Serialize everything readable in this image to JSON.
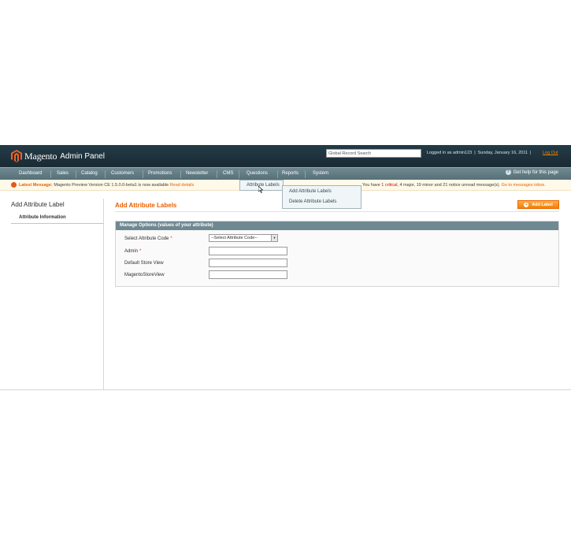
{
  "header": {
    "logo_text": "Magento",
    "logo_sub": "Admin Panel",
    "search_value": "Global Record Search",
    "user_info": "Logged in as admin123",
    "date_info": "Sunday, January 16, 2011",
    "logout_label": "Log Out"
  },
  "nav": {
    "items": [
      "Dashboard",
      "Sales",
      "Catalog",
      "Customers",
      "Promotions",
      "Newsletter",
      "CMS",
      "Questions",
      "Reports",
      "System"
    ],
    "help_label": "Get help for this page",
    "dropdown_parent": "Attribute Labels",
    "dropdown_items": [
      "Add Attribute Labels",
      "Delete Attribute Labels"
    ]
  },
  "notice": {
    "label": "Latest Message:",
    "message": "Magento Preview Version CE 1.5.0.0-beta1 is now available",
    "link": "Read details",
    "summary_prefix": "You have",
    "critical_count": "1 critical",
    "major": "4 major",
    "minor": "19 minor and",
    "notice_count": "21 notice unread message(s).",
    "goto": "Go to messages inbox."
  },
  "sidebar": {
    "title": "Add Attribute Label",
    "tab": "Attribute Information"
  },
  "main": {
    "title": "Add Attribute Labels",
    "add_button": "Add Label",
    "fieldset_title": "Manage Options (values of your attribute)",
    "fields": [
      {
        "label": "Select Attribute Code",
        "required": "*",
        "value": "--Select Attribute Code--"
      },
      {
        "label": "Admin",
        "required": "*",
        "value": ""
      },
      {
        "label": "Default Store View",
        "value": ""
      },
      {
        "label": "MagentoStoreView",
        "value": ""
      }
    ]
  },
  "colors": {
    "header_bg": "#1a2a33",
    "nav_bg": "#6f8992",
    "accent": "#eb5e00",
    "notice_bg": "#fff9e9"
  }
}
